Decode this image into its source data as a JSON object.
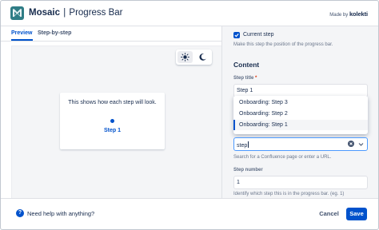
{
  "header": {
    "app_name": "Mosaic",
    "separator": "|",
    "app_subtitle": "Progress Bar",
    "made_by_label": "Made by",
    "brand": "kolekti",
    "logo_icon": "mosaic-logo-icon"
  },
  "tabs": [
    {
      "label": "Preview",
      "active": true
    },
    {
      "label": "Step-by-step",
      "active": false
    }
  ],
  "preview": {
    "theme_toggle": {
      "light_icon": "sun-icon",
      "dark_icon": "moon-icon",
      "selected": "light"
    },
    "card_text": "This shows how each step will look.",
    "step_label": "Step 1"
  },
  "form": {
    "current_step": {
      "checked": true,
      "label": "Current step",
      "help": "Make this step the position of the progress bar."
    },
    "section_title": "Content",
    "step_title": {
      "label": "Step title",
      "required_mark": "*",
      "value": "Step 1"
    },
    "dropdown_options": [
      {
        "label": "Onboarding: Step 3",
        "selected": false
      },
      {
        "label": "Onboarding: Step 2",
        "selected": false
      },
      {
        "label": "Onboarding: Step 1",
        "selected": true
      }
    ],
    "link_search": {
      "value": "step",
      "help": "Search for a Confluence page or enter a URL."
    },
    "step_number": {
      "label": "Step number",
      "value": "1",
      "help": "Identify which step this is in the progress bar. (eg. 1)"
    }
  },
  "footer": {
    "help_text": "Need help with anything?",
    "cancel_label": "Cancel",
    "save_label": "Save"
  },
  "colors": {
    "primary": "#0052cc",
    "focus_border": "#4c9aff",
    "panel_bg": "#f4f5f7",
    "text": "#172b4d"
  }
}
